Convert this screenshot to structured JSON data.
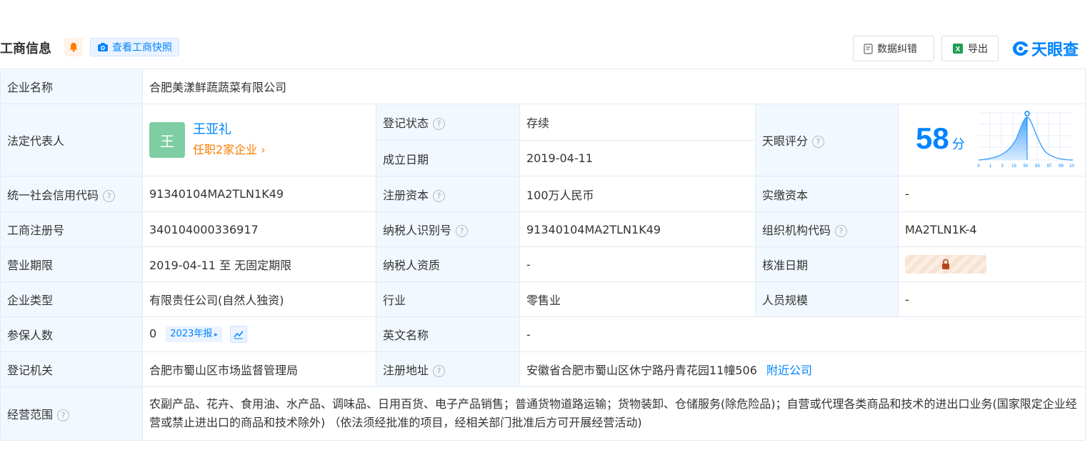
{
  "header": {
    "title": "工商信息",
    "snapshot_label": "查看工商快照",
    "correction_label": "数据纠错",
    "export_label": "导出",
    "logo_text": "天眼查"
  },
  "company": {
    "name_label": "企业名称",
    "name": "合肥美漾鲜蔬蔬菜有限公司",
    "legal_rep_label": "法定代表人",
    "legal_rep_avatar": "王",
    "legal_rep_name": "王亚礼",
    "legal_rep_positions": "任职2家企业",
    "reg_status_label": "登记状态",
    "reg_status": "存续",
    "founded_label": "成立日期",
    "founded": "2019-04-11",
    "score_label": "天眼评分",
    "score": "58",
    "score_unit": "分",
    "score_axis": [
      "0",
      "1",
      "3",
      "15",
      "50",
      "85",
      "97",
      "99",
      "100"
    ],
    "credit_code_label": "统一社会信用代码",
    "credit_code": "91340104MA2TLN1K49",
    "reg_capital_label": "注册资本",
    "reg_capital": "100万人民币",
    "paid_capital_label": "实缴资本",
    "paid_capital": "-",
    "reg_no_label": "工商注册号",
    "reg_no": "340104000336917",
    "taxpayer_id_label": "纳税人识别号",
    "taxpayer_id": "91340104MA2TLN1K49",
    "org_code_label": "组织机构代码",
    "org_code": "MA2TLN1K-4",
    "term_label": "营业期限",
    "term": "2019-04-11 至 无固定期限",
    "taxpayer_qual_label": "纳税人资质",
    "taxpayer_qual": "-",
    "approved_date_label": "核准日期",
    "type_label": "企业类型",
    "type": "有限责任公司(自然人独资)",
    "industry_label": "行业",
    "industry": "零售业",
    "staff_size_label": "人员规模",
    "staff_size": "-",
    "insured_label": "参保人数",
    "insured": "0",
    "insured_report": "2023年报",
    "english_name_label": "英文名称",
    "english_name": "-",
    "authority_label": "登记机关",
    "authority": "合肥市蜀山区市场监督管理局",
    "address_label": "注册地址",
    "address": "安徽省合肥市蜀山区休宁路丹青花园11幢506",
    "nearby_label": "附近公司",
    "scope_label": "经营范围",
    "scope": "农副产品、花卉、食用油、水产品、调味品、日用百货、电子产品销售；普通货物道路运输；货物装卸、仓储服务(除危险品)；自营或代理各类商品和技术的进出口业务(国家限定企业经营或禁止进出口的商品和技术除外) （依法须经批准的项目，经相关部门批准后方可开展经营活动)"
  },
  "colors": {
    "accent": "#0084ff",
    "status_green": "#009a61",
    "orange": "#ff7a00",
    "label_bg": "#f2f8ff"
  }
}
